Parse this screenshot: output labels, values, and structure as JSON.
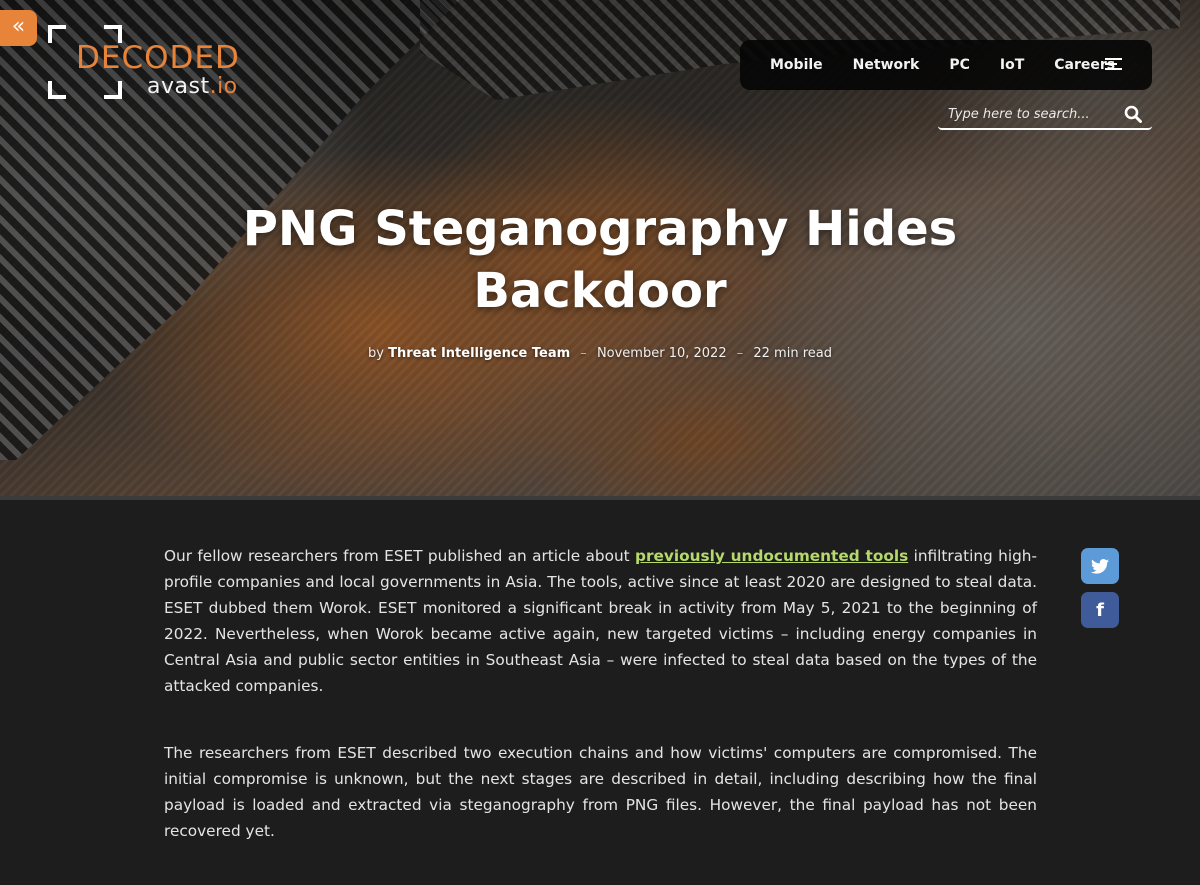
{
  "header": {
    "collapse_icon_glyph": "«",
    "logo": {
      "decoded": "DECODED",
      "avast": "avast",
      "io": ".io"
    },
    "nav": [
      {
        "label": "Mobile"
      },
      {
        "label": "Network"
      },
      {
        "label": "PC"
      },
      {
        "label": "IoT"
      },
      {
        "label": "Careers"
      }
    ],
    "search": {
      "placeholder": "Type here to search...",
      "value": ""
    }
  },
  "article": {
    "title": "PNG Steganography Hides Backdoor",
    "meta": {
      "by": "by",
      "author": "Threat Intelligence Team",
      "separator": "–",
      "date": "November 10, 2022",
      "read_time": "22 min read"
    },
    "paragraphs": [
      {
        "before": "Our fellow researchers from ESET published an article about ",
        "link": "previously undocumented tools",
        "after": " infiltrating high-profile companies and local governments in Asia. The tools, active since at least 2020 are designed to steal data. ESET dubbed them Worok. ESET monitored a significant break in activity from May 5, 2021 to the beginning of 2022. Nevertheless, when Worok became active again, new targeted victims – including energy companies in Central Asia and public sector entities in Southeast Asia – were infected to steal data based on the types of the attacked companies."
      },
      {
        "text": "The researchers from ESET described two execution chains and how victims' computers are compromised. The initial compromise is unknown, but the next stages are described in detail, including describing how the final payload is loaded and extracted via steganography from PNG files. However, the final payload has not been recovered yet."
      }
    ]
  },
  "social": {
    "twitter_glyph": "twitter",
    "facebook_glyph": "f"
  },
  "colors": {
    "accent_orange": "#e8833a",
    "link_green": "#b5d96a",
    "twitter_blue": "#5c9bd8",
    "facebook_blue": "#3f5b9a",
    "page_background": "#1d1d1d"
  }
}
